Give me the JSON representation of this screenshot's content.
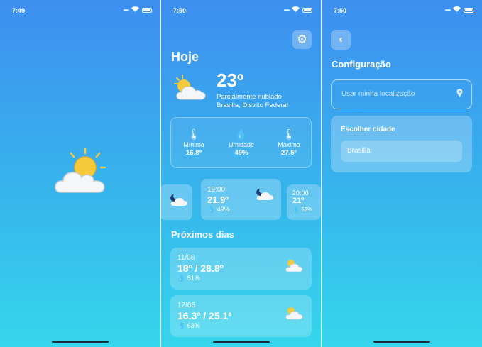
{
  "status": {
    "s1_time": "7:49",
    "s2_time": "7:50",
    "s3_time": "7:50"
  },
  "icons": {
    "splash": "partly-cloudy-day-icon",
    "settings": "gear-icon",
    "back": "chevron-left-icon",
    "location": "location-pin-icon"
  },
  "today": {
    "title": "Hoje",
    "temp": "23º",
    "desc": "Parcialmente nublado",
    "place": "Brasilia, Distrito Federal",
    "min_label": "Mínima",
    "min_value": "16.8º",
    "hum_label": "Umidade",
    "hum_value": "49%",
    "max_label": "Máxima",
    "max_value": "27.5º"
  },
  "hourly": [
    {
      "time": "",
      "temp": "",
      "hum": ""
    },
    {
      "time": "19:00",
      "temp": "21.9º",
      "hum": "49%"
    },
    {
      "time": "20:00",
      "temp": "21º",
      "hum": "52%"
    }
  ],
  "next": {
    "title": "Próximos dias",
    "days": [
      {
        "date": "11/06",
        "temps": "18º / 28.8º",
        "hum": "51%"
      },
      {
        "date": "12/06",
        "temps": "16.3º / 25.1º",
        "hum": "63%"
      }
    ]
  },
  "config": {
    "title": "Configuração",
    "use_location": "Usar minha localização",
    "choose_city": "Escolher cidade",
    "city_value": "Brasilia"
  },
  "colors": {
    "gradient_top": "#3e8ff0",
    "gradient_bottom": "#36d6ec",
    "sun": "#f6c93a",
    "cloud": "#f4f6f8"
  }
}
